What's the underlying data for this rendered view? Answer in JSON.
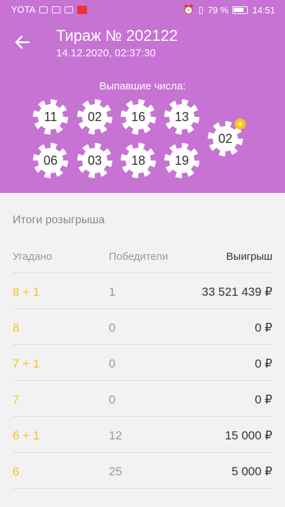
{
  "status": {
    "carrier": "YOTA",
    "battery": "79 %",
    "time": "14:51"
  },
  "header": {
    "title": "Тираж № 202122",
    "datetime": "14.12.2020, 02:37:30",
    "drawn_label": "Выпавшие числа:",
    "numbers_row1": [
      "11",
      "02",
      "16",
      "13"
    ],
    "numbers_row2": [
      "06",
      "03",
      "18",
      "19"
    ],
    "bonus_number": "02",
    "bonus_badge": "+"
  },
  "results": {
    "title": "Итоги розыгрыша",
    "columns": [
      "Угадано",
      "Победители",
      "Выигрыш"
    ],
    "rows": [
      [
        "8 + 1",
        "1",
        "33 521 439 ₽"
      ],
      [
        "8",
        "0",
        "0 ₽"
      ],
      [
        "7 + 1",
        "0",
        "0 ₽"
      ],
      [
        "7",
        "0",
        "0 ₽"
      ],
      [
        "6 + 1",
        "12",
        "15 000 ₽"
      ],
      [
        "6",
        "25",
        "5 000 ₽"
      ]
    ]
  },
  "colors": {
    "header": "#c673d4",
    "accent": "#f5c518"
  }
}
